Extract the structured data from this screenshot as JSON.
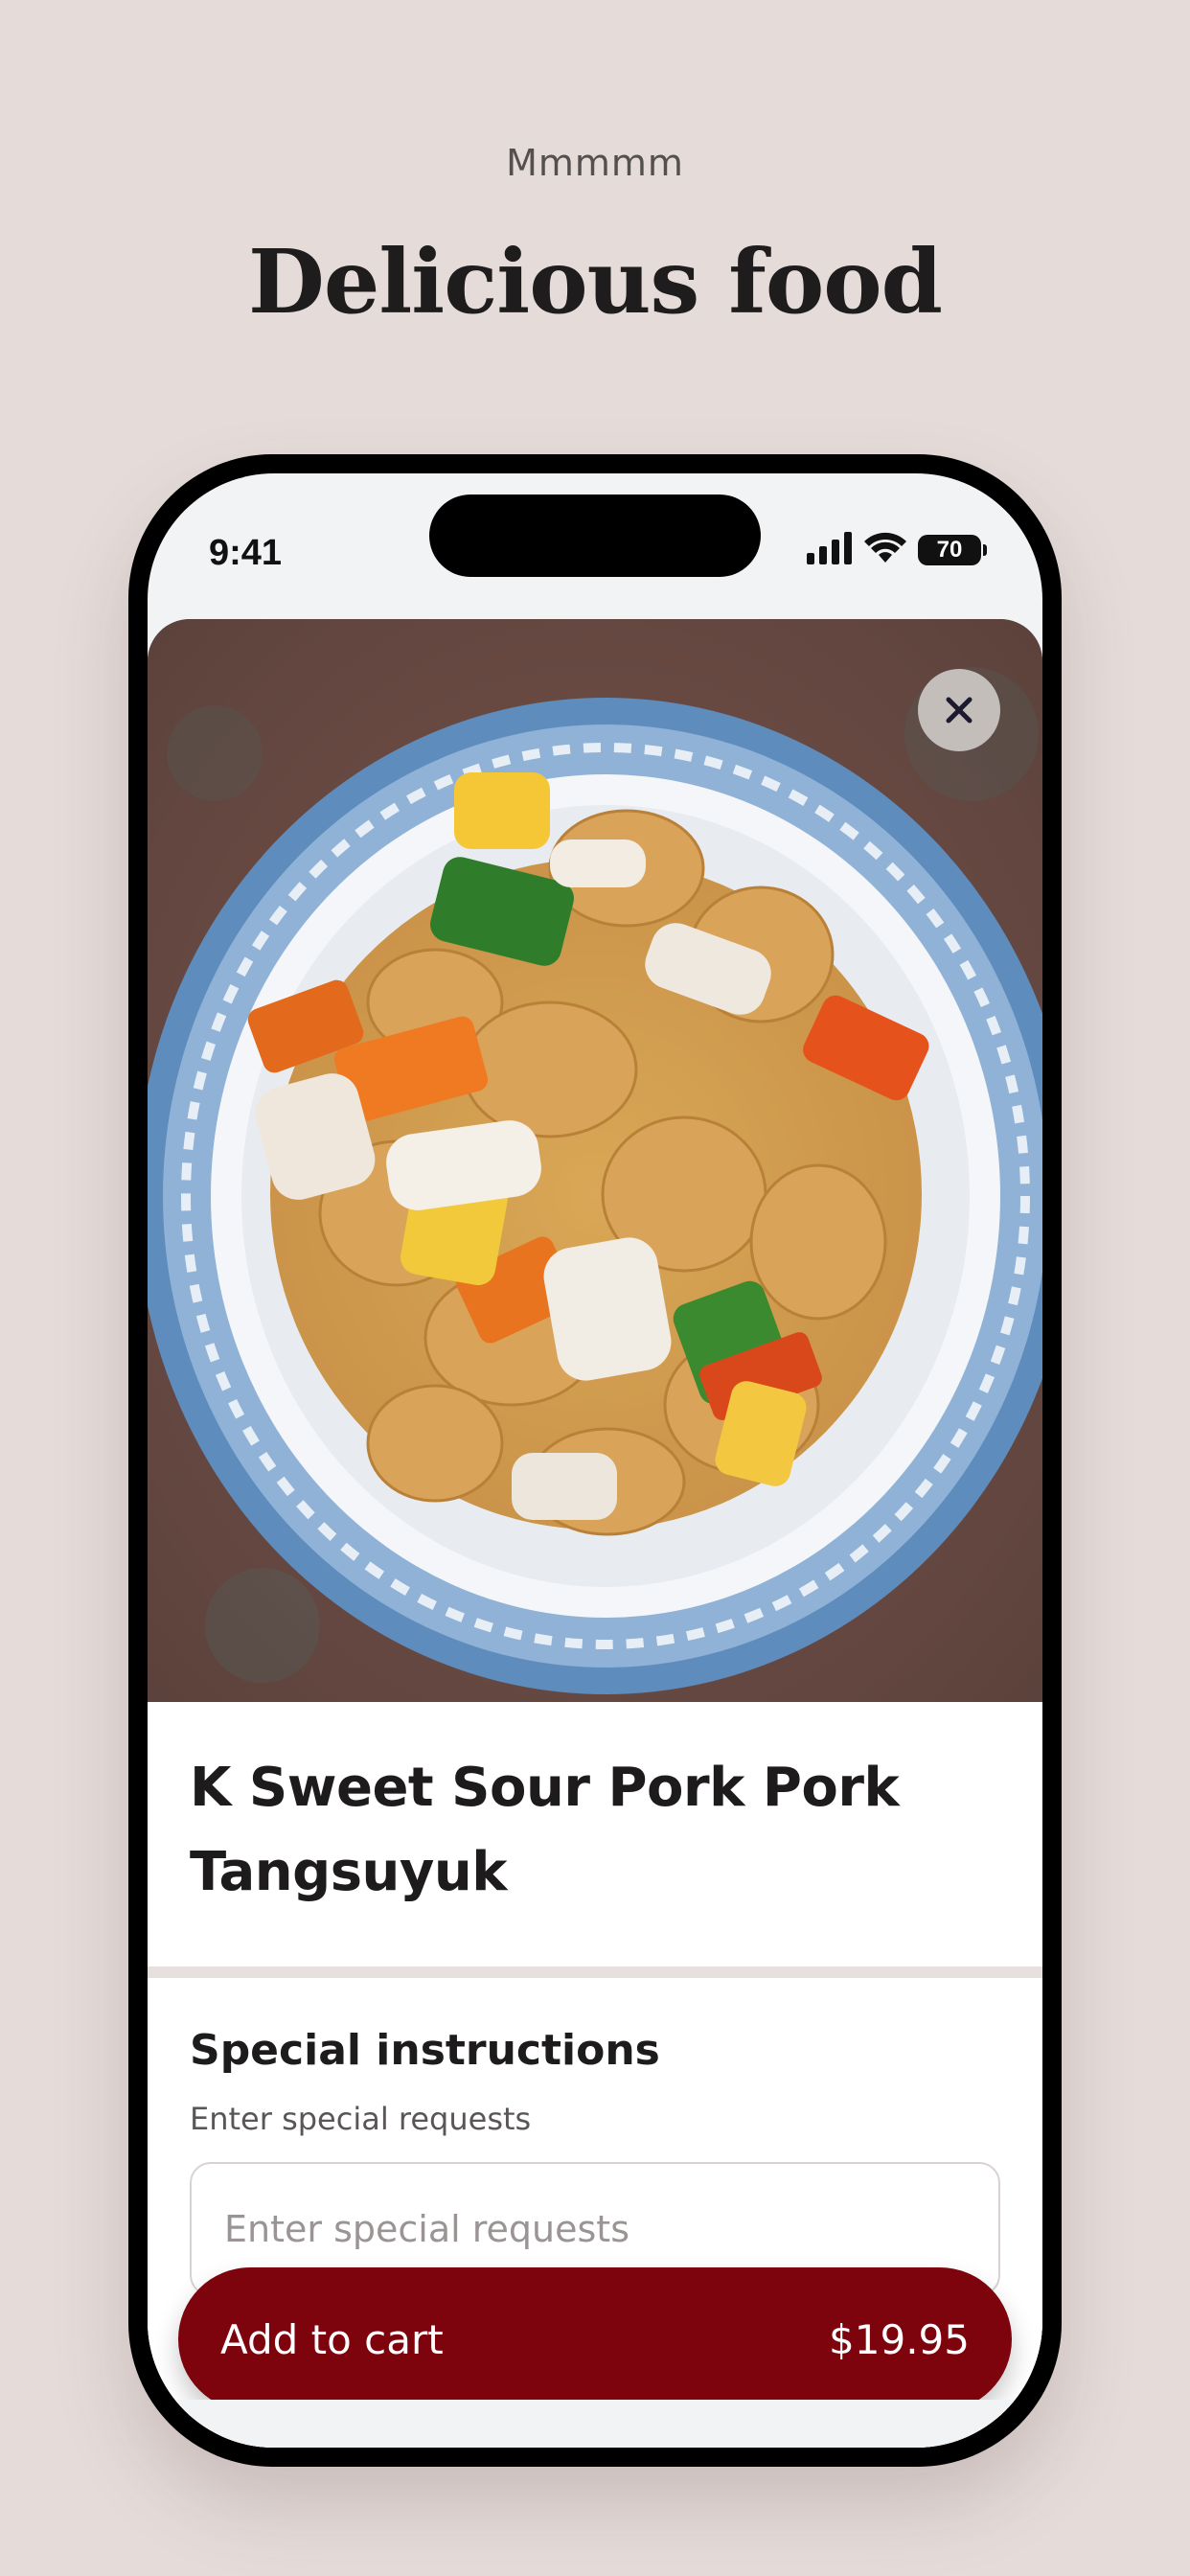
{
  "header": {
    "eyebrow": "Mmmmm",
    "headline": "Delicious food"
  },
  "status_bar": {
    "time": "9:41",
    "battery": "70"
  },
  "item": {
    "title": "K Sweet Sour Pork Pork Tangsuyuk"
  },
  "special_instructions": {
    "title": "Special instructions",
    "subtitle": "Enter special requests",
    "placeholder": "Enter special requests"
  },
  "cart": {
    "label": "Add to cart",
    "price": "$19.95"
  },
  "colors": {
    "background": "#e5dcd9",
    "accent": "#7d030c"
  },
  "icons": {
    "close": "close-icon",
    "signal": "cellular-signal-icon",
    "wifi": "wifi-icon",
    "battery": "battery-icon"
  }
}
